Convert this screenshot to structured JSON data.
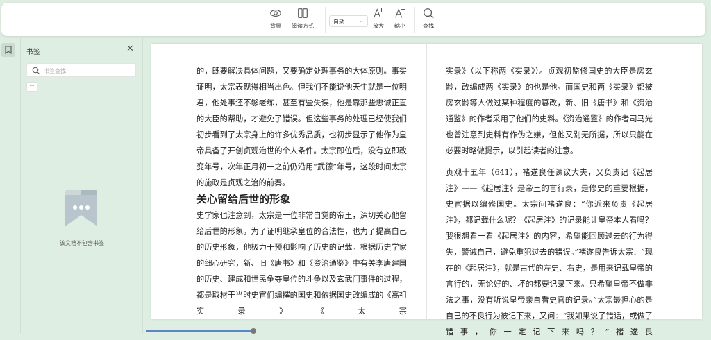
{
  "toolbar": {
    "background": "背景",
    "reading_mode": "阅读方式",
    "zoom_select": "自动",
    "zoom_in": "放大",
    "zoom_out": "缩小",
    "find": "查找"
  },
  "sidebar": {
    "title": "书签",
    "search_placeholder": "书签查找",
    "more": "···",
    "empty": "该文档不包含书签"
  },
  "left_page": {
    "lines": [
      "的，既要解决具体问题，又要确定处理事务的大体原则。事实证明，太宗表现得相当出色。但我们不能说他天生就是一位明君，他处事还不够老练，甚至有些失误，他是靠那些忠诚正直的大臣的帮助，才避免了错误。但这些事务的处理已经使我们初步看到了太宗身上的许多优秀品质，也初步显示了他作为皇帝具备了开创贞观治世的个人条件。太宗即位后，没有立即改变年号，次年正月初一之前仍沿用“武德”年号，这段时间太宗的施政是贞观之治的前奏。"
    ],
    "heading": "关心留给后世的形象",
    "para2": "史学家也注意到，太宗是一位非常自觉的帝王，深切关心他留给后世的形象。为了证明继承皇位的合法性，也为了提高自己的历史形象，他极力干预和影响了历史的记载。根据历史学家的细心研究，新、旧《唐书》和《资治通鉴》中有关李唐建国的历史、建成和世民争夺皇位的斗争以及玄武门事件的过程，都是取材于当时史官们编撰的国史和依据国史改编成的《高祖实录》《太宗"
  },
  "right_page": {
    "para1": "实录》（以下称两《实录》）。贞观初监修国史的大臣是房玄龄，改编成两《实录》的也是他。而国史和两《实录》都被房玄龄等人做过某种程度的篡改，新、旧《唐书》和《资治通鉴》的作者采用了他们的史料。《资治通鉴》的作者司马光也曾注意到史料有作伪之嫌，但他又别无所据，所以只能在必要时略做提示，以引起读者的注意。",
    "para2": "贞观十五年（641），褚遂良任谏议大夫，又负责记《起居注》——《起居注》是帝王的言行录，是修史的重要根据，史官据以编修国史。太宗问褚遂良：“你近来负责《起居注》，都记载什么呢？《起居注》的记录能让皇帝本人看吗？我很想看一看《起居注》的内容，希望能回顾过去的行为得失，警诫自己，避免重犯过去的错误。”褚遂良告诉太宗：“现在的《起居注》，就是古代的左史、右史，是用来记载皇帝的言行的，无论好的、坏的都要记录下来。只希望皇帝不做非法之事，没有听说皇帝亲自看史官的记录。”太宗最担心的是自己的不良行为被记下来，又问：“我如果说了错话，或做了错事，你一定记下来吗？”褚遂良"
  },
  "reading_progress": 0.19
}
